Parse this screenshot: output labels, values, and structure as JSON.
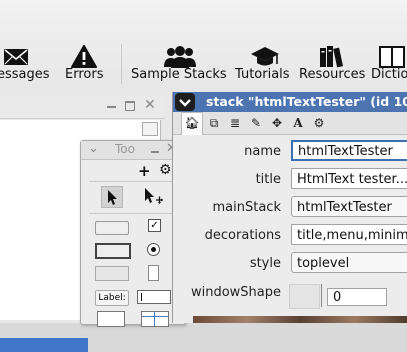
{
  "toolbar": {
    "messages_label": "essages",
    "errors_label": "Errors",
    "sample_stacks_label": "Sample Stacks",
    "tutorials_label": "Tutorials",
    "resources_label": "Resources",
    "dictionary_label": "Dictio"
  },
  "tools_palette": {
    "title": "Too",
    "label_field_text": "Label:"
  },
  "inspector": {
    "title": "stack \"htmlTextTester\" (id 101",
    "props": {
      "name_label": "name",
      "name_value": "htmlTextTester",
      "title_label": "title",
      "title_value": "HtmlText tester...",
      "mainstack_label": "mainStack",
      "mainstack_value": "htmlTextTester",
      "decorations_label": "decorations",
      "decorations_value": "title,menu,minimi",
      "style_label": "style",
      "style_value": "toplevel",
      "windowshape_label": "windowShape",
      "windowshape_value": "0"
    }
  }
}
